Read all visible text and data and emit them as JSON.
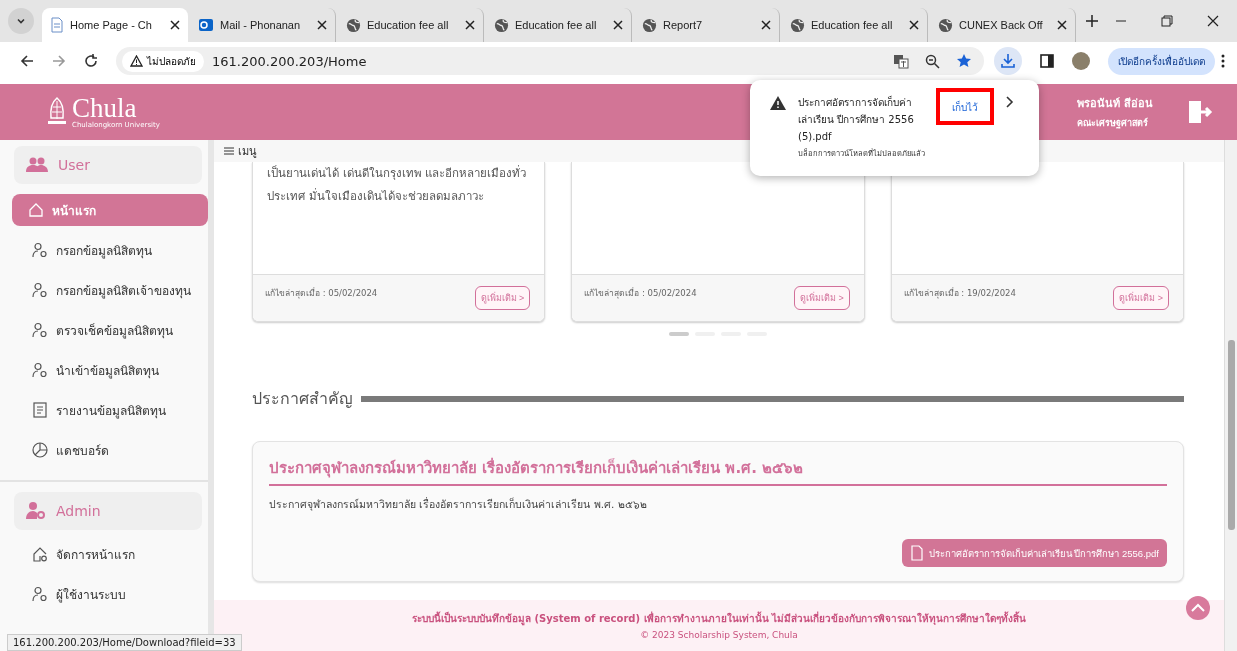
{
  "browser": {
    "tabs": [
      {
        "title": "Home Page - Ch",
        "selected": true,
        "kind": "doc"
      },
      {
        "title": "Mail - Phonanan",
        "selected": false,
        "kind": "mail"
      },
      {
        "title": "Education fee all",
        "selected": false,
        "kind": "globe"
      },
      {
        "title": "Education fee all",
        "selected": false,
        "kind": "globe"
      },
      {
        "title": "Report7",
        "selected": false,
        "kind": "globe"
      },
      {
        "title": "Education fee all",
        "selected": false,
        "kind": "globe"
      },
      {
        "title": "CUNEX Back Off",
        "selected": false,
        "kind": "globe"
      }
    ],
    "security_label": "ไม่ปลอดภัย",
    "url": "161.200.200.203/Home",
    "update_button": "เปิดอีกครั้งเพื่ออัปเดต",
    "status_url": "161.200.200.203/Home/Download?fileid=33"
  },
  "download_popup": {
    "filename": "ประกาศอัตราการจัดเก็บค่าเล่าเรียน ปีการศึกษา 2556 (5).pdf",
    "note": "บล็อกการดาวน์โหลดที่ไม่ปลอดภัยแล้ว",
    "keep_button": "เก็บไว้"
  },
  "header": {
    "logo": "Chula",
    "logo_sub": "Chulalongkorn University",
    "user_name": "พรอนันท์ สีอ่อน",
    "faculty": "คณะเศรษฐศาสตร์"
  },
  "sidebar": {
    "groups": [
      {
        "title": "User",
        "kind": "users",
        "items": [
          {
            "label": "หน้าแรก",
            "selected": true,
            "kind": "home"
          },
          {
            "label": "กรอกข้อมูลนิสิตทุน",
            "selected": false,
            "kind": "user"
          },
          {
            "label": "กรอกข้อมูลนิสิตเจ้าของทุน",
            "selected": false,
            "kind": "user"
          },
          {
            "label": "ตรวจเช็คข้อมูลนิสิตทุน",
            "selected": false,
            "kind": "user"
          },
          {
            "label": "นำเข้าข้อมูลนิสิตทุน",
            "selected": false,
            "kind": "user"
          },
          {
            "label": "รายงานข้อมูลนิสิตทุน",
            "selected": false,
            "kind": "report"
          },
          {
            "label": "แดชบอร์ด",
            "selected": false,
            "kind": "dashboard"
          }
        ]
      },
      {
        "title": "Admin",
        "kind": "admin",
        "items": [
          {
            "label": "จัดการหน้าแรก",
            "selected": false,
            "kind": "homegear"
          },
          {
            "label": "ผู้ใช้งานระบบ",
            "selected": false,
            "kind": "user"
          }
        ]
      }
    ]
  },
  "menu_label": "เมนู",
  "cards": [
    {
      "text": "เป็นยานเด่นได้ เด่นดีในกรุงเทพ และอีกหลายเมืองทั่วประเทศ มั่นใจเมืองเดินได้จะช่วยลดมลภาวะ",
      "updated": "แก้ไขล่าสุดเมื่อ : 05/02/2024",
      "button": "ดูเพิ่มเติม >"
    },
    {
      "updated": "แก้ไขล่าสุดเมื่อ : 05/02/2024",
      "button": "ดูเพิ่มเติม >"
    },
    {
      "updated": "แก้ไขล่าสุดเมื่อ : 19/02/2024",
      "button": "ดูเพิ่มเติม >"
    }
  ],
  "carousel_dots": [
    {
      "selected": true
    },
    {
      "selected": false
    },
    {
      "selected": false
    },
    {
      "selected": false
    }
  ],
  "announcements_heading": "ประกาศสำคัญ",
  "announcement": {
    "title": "ประกาศจุฬาลงกรณ์มหาวิทยาลัย เรื่องอัตราการเรียกเก็บเงินค่าเล่าเรียน พ.ศ. ๒๕๖๒",
    "body": "ประกาศจุฬาลงกรณ์มหาวิทยาลัย เรื่องอัตราการเรียกเก็บเงินค่าเล่าเรียน พ.ศ. ๒๕๖๒",
    "file_button": "ประกาศอัตราการจัดเก็บค่าเล่าเรียน ปีการศึกษา 2556.pdf"
  },
  "footer": {
    "notice": "ระบบนี้เป็นระบบบันทึกข้อมูล (System of record) เพื่อการทำงานภายในเท่านั้น ไม่มีส่วนเกี่ยวข้องกับการพิจารณาให้ทุนการศึกษาใดๆทั้งสิ้น",
    "copyright": "© 2023 Scholarship System, Chula"
  }
}
